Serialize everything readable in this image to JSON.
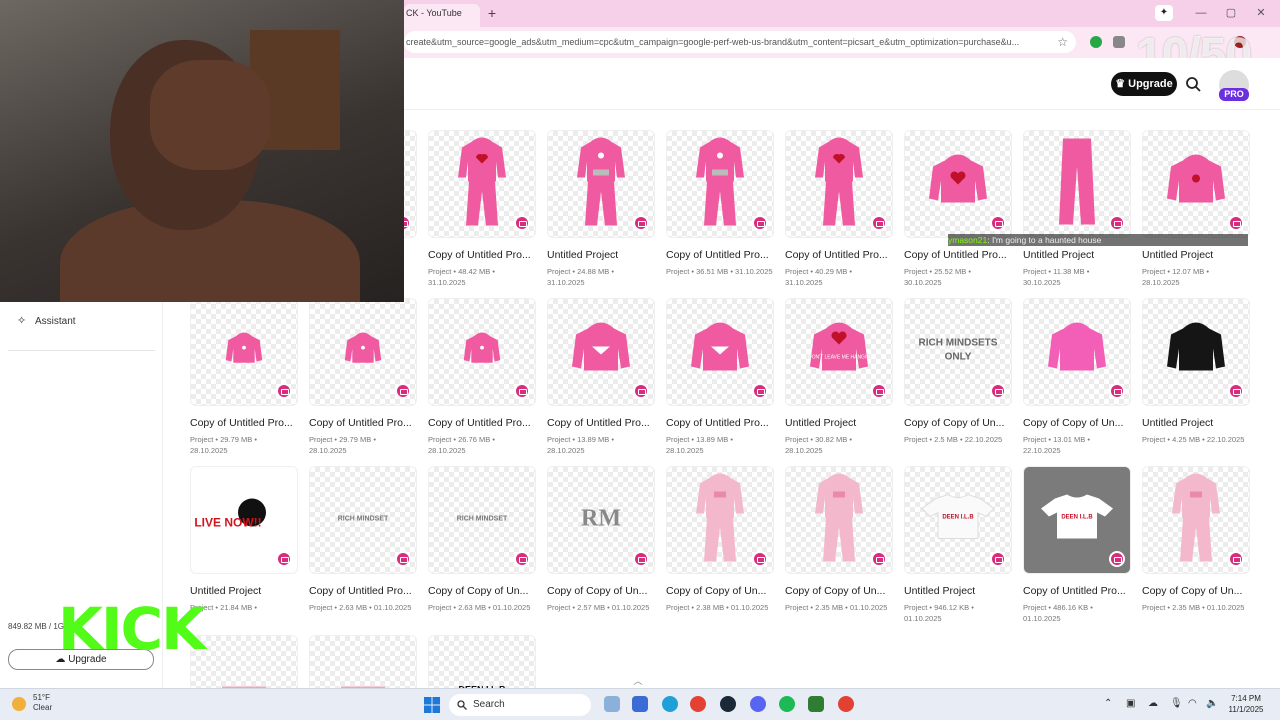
{
  "browser": {
    "tab_title": "CK - YouTube",
    "new_tab": "+",
    "url": "create&utm_source=google_ads&utm_medium=cpc&utm_campaign=google-perf-web-us-brand&utm_content=picsart_e&utm_optimization=purchase&u...",
    "pinned_icon": "✦",
    "window_buttons": [
      "—",
      "▢",
      "✕"
    ]
  },
  "overlay": {
    "counter": "10/50",
    "kick_logo": "KICK",
    "chat_user": "ymason21",
    "chat_message": ": I'm going to a haunted house"
  },
  "header": {
    "upgrade_label": "Upgrade",
    "pro_badge": "PRO"
  },
  "sidebar": {
    "assistant_label": "Assistant",
    "storage": "849.82 MB / 1G",
    "upgrade_label": "Upgrade"
  },
  "projects": [
    {
      "title": "Copy of Untitled Pro...",
      "meta1": "Project • 48.42 MB •",
      "meta2": "31.10.2025",
      "art": "hoodie-set-heart"
    },
    {
      "title": "Untitled Project",
      "meta1": "Project • 24.88 MB •",
      "meta2": "31.10.2025",
      "art": "hoodie-set-logo"
    },
    {
      "title": "Copy of Untitled Pro...",
      "meta1": "Project • 36.51 MB • 31.10.2025",
      "meta2": "",
      "art": "hoodie-set-logo"
    },
    {
      "title": "Copy of Untitled Pro...",
      "meta1": "Project • 40.29 MB •",
      "meta2": "31.10.2025",
      "art": "hoodie-set-heart"
    },
    {
      "title": "Copy of Untitled Pro...",
      "meta1": "Project • 25.52 MB •",
      "meta2": "30.10.2025",
      "art": "crop-hoodie-heart"
    },
    {
      "title": "Untitled Project",
      "meta1": "Project • 11.38 MB •",
      "meta2": "30.10.2025",
      "art": "pants"
    },
    {
      "title": "Untitled Project",
      "meta1": "Project • 12.07 MB •",
      "meta2": "28.10.2025",
      "art": "crop-hoodie-logo"
    },
    {
      "title": "Copy of Untitled Pro...",
      "meta1": "Project • 29.79 MB •",
      "meta2": "28.10.2025",
      "art": "crop-hoodie-small"
    },
    {
      "title": "Copy of Untitled Pro...",
      "meta1": "Project • 29.79 MB •",
      "meta2": "28.10.2025",
      "art": "crop-hoodie-small"
    },
    {
      "title": "Copy of Untitled Pro...",
      "meta1": "Project • 26.76 MB •",
      "meta2": "28.10.2025",
      "art": "crop-hoodie-small"
    },
    {
      "title": "Copy of Untitled Pro...",
      "meta1": "Project • 13.89 MB •",
      "meta2": "28.10.2025",
      "art": "crop-hoodie-back"
    },
    {
      "title": "Copy of Untitled Pro...",
      "meta1": "Project • 13.89 MB •",
      "meta2": "28.10.2025",
      "art": "crop-hoodie-back"
    },
    {
      "title": "Untitled Project",
      "meta1": "Project • 30.82 MB •",
      "meta2": "28.10.2025",
      "art": "crop-hoodie-text"
    },
    {
      "title": "Copy of Copy of Un...",
      "meta1": "Project • 2.5 MB • 22.10.2025",
      "meta2": "",
      "art": "text-rich-mindsets"
    },
    {
      "title": "Copy of Copy of Un...",
      "meta1": "Project • 13.01 MB •",
      "meta2": "22.10.2025",
      "art": "crop-hoodie-pink"
    },
    {
      "title": "Untitled Project",
      "meta1": "Project • 4.25 MB • 22.10.2025",
      "meta2": "",
      "art": "crop-hoodie-black"
    },
    {
      "title": "Untitled Project",
      "meta1": "Project • 21.84 MB •",
      "meta2": "",
      "art": "live-now"
    },
    {
      "title": "Copy of Untitled Pro...",
      "meta1": "Project • 2.63 MB • 01.10.2025",
      "meta2": "",
      "art": "text-rich-mindset"
    },
    {
      "title": "Copy of Copy of Un...",
      "meta1": "Project • 2.63 MB • 01.10.2025",
      "meta2": "",
      "art": "text-rich-mindset"
    },
    {
      "title": "Copy of Copy of Un...",
      "meta1": "Project • 2.57 MB • 01.10.2025",
      "meta2": "",
      "art": "rm-logo"
    },
    {
      "title": "Copy of Copy of Un...",
      "meta1": "Project • 2.38 MB • 01.10.2025",
      "meta2": "",
      "art": "sweatsuit-light"
    },
    {
      "title": "Copy of Copy of Un...",
      "meta1": "Project • 2.35 MB • 01.10.2025",
      "meta2": "",
      "art": "sweatsuit-light"
    },
    {
      "title": "Untitled Project",
      "meta1": "Project • 946.12 KB •",
      "meta2": "01.10.2025",
      "art": "crop-tee-white"
    },
    {
      "title": "Copy of Untitled Pro...",
      "meta1": "Project • 486.16 KB •",
      "meta2": "01.10.2025",
      "art": "crop-tee-grey"
    },
    {
      "title": "Copy of Copy of Un...",
      "meta1": "Project • 2.35 MB • 01.10.2025",
      "meta2": "",
      "art": "sweatsuit-light"
    },
    {
      "title": "",
      "meta1": "",
      "meta2": "",
      "art": "partial-pink-text"
    },
    {
      "title": "",
      "meta1": "",
      "meta2": "",
      "art": "partial-pink-text"
    },
    {
      "title": "",
      "meta1": "",
      "meta2": "",
      "art": "partial-deen"
    }
  ],
  "art_text": {
    "rich_mindsets": "RICH MINDSETS ONLY",
    "rich_mindset": "RICH MINDSET",
    "rm": "RM",
    "live_now": "LIVE NOW!!",
    "deen": "DEEN I.L.B",
    "dont_leave": "DON'T LEAVE ME HANGIN"
  },
  "taskbar": {
    "temp": "51°F",
    "condition": "Clear",
    "search_label": "Search",
    "time": "7:14 PM",
    "date": "11/1/2025"
  },
  "colors": {
    "pink": "#ef5aa0",
    "light_pink": "#f3b8cc",
    "brand_magenta": "#d82c7c",
    "pro_purple": "#6b2fe0",
    "kick_green": "#53fc18"
  }
}
